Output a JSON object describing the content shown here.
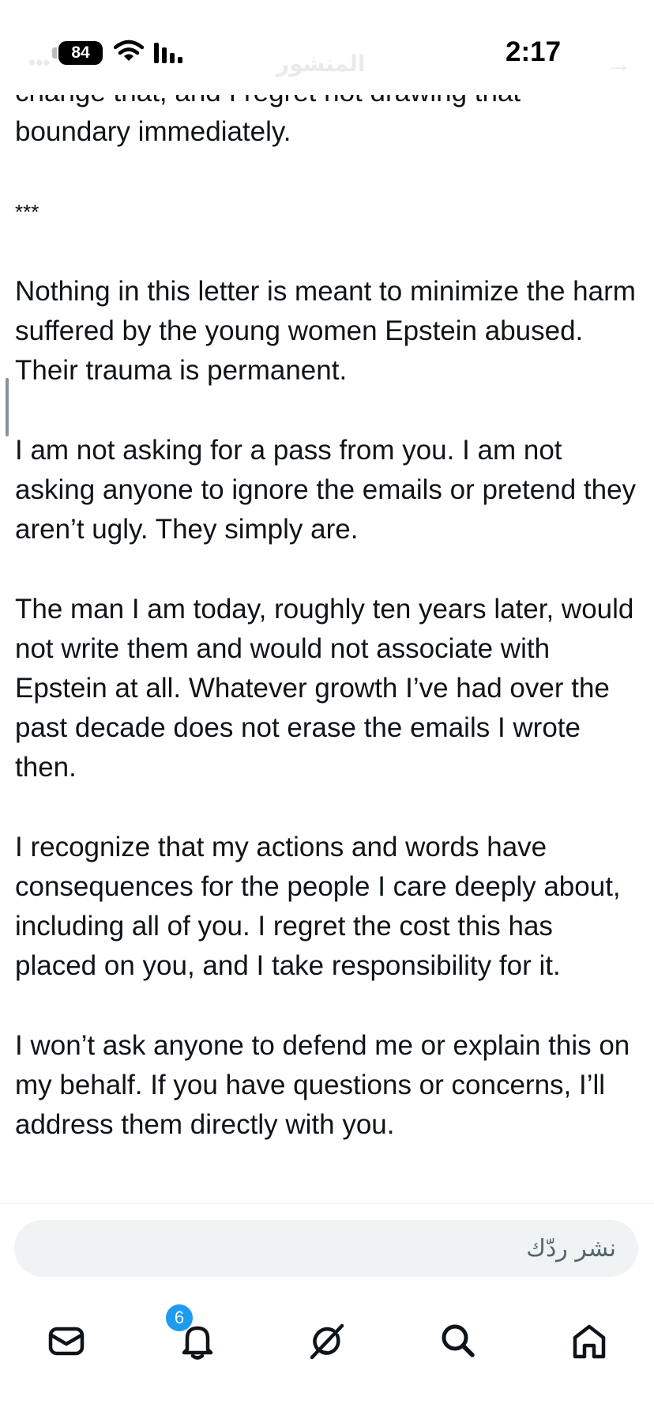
{
  "status_bar": {
    "battery": "84",
    "time": "2:17"
  },
  "header": {
    "title": "المنشور"
  },
  "post": {
    "paragraphs": [
      "change that, and I regret not drawing that boundary immediately.",
      "***",
      "Nothing in this letter is meant to minimize the harm suffered by the young women Epstein abused. Their trauma is permanent.",
      "I am not asking for a pass from you. I am not asking anyone to ignore the emails or pretend they aren’t ugly. They simply are.",
      "The man I am today, roughly ten years later, would not write them and would not associate with Epstein at all. Whatever growth I’ve had over the past decade does not erase the emails I wrote then.",
      "I recognize that my actions and words have consequences for the people I care deeply about, including all of you. I regret the cost this has placed on you, and I take responsibility for it.",
      "I won’t ask anyone to defend me or explain this on my behalf. If you have questions or concerns, I’ll address them directly with you."
    ]
  },
  "reply": {
    "placeholder": "نشر ردّك"
  },
  "nav": {
    "notifications_badge": "6",
    "icons": [
      "mail-icon",
      "bell-icon",
      "grok-icon",
      "search-icon",
      "home-icon"
    ]
  }
}
